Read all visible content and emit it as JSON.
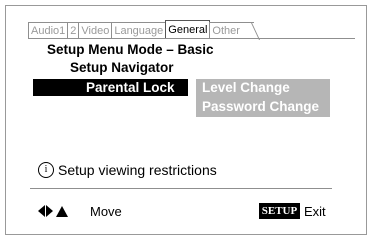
{
  "tabs": [
    {
      "label": "Audio1",
      "active": false
    },
    {
      "label": "2",
      "active": false
    },
    {
      "label": "Video",
      "active": false
    },
    {
      "label": "Language",
      "active": false
    },
    {
      "label": "General",
      "active": true
    },
    {
      "label": "Other",
      "active": false
    }
  ],
  "menu": {
    "title": "Setup Menu Mode – Basic",
    "navigator": "Setup Navigator",
    "selected_item": "Parental Lock",
    "submenu": [
      "Level Change",
      "Password Change"
    ]
  },
  "info": {
    "icon": "info-icon",
    "symbol": "i",
    "text": "Setup viewing restrictions"
  },
  "footer": {
    "move_icon": "arrow-keys-icon",
    "move_label": "Move",
    "setup_key": "SETUP",
    "exit_label": "Exit"
  }
}
